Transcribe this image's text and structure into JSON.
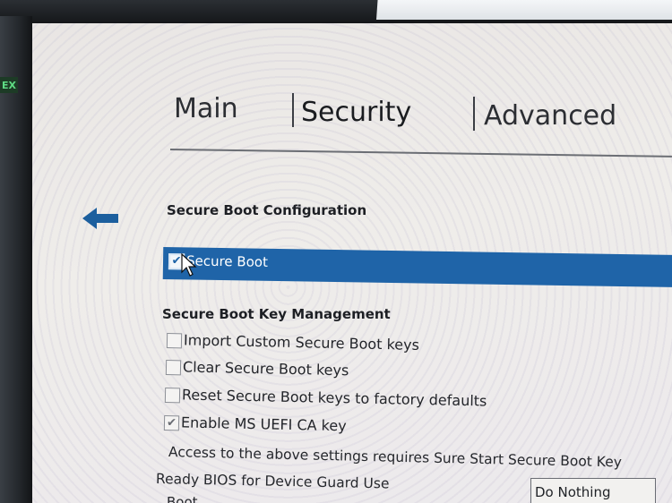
{
  "exit_sign": "EX",
  "tabs": [
    {
      "label": "Main"
    },
    {
      "label": "Security"
    },
    {
      "label": "Advanced"
    }
  ],
  "active_tab": "Security",
  "sections": {
    "secure_boot_configuration": "Secure Boot Configuration",
    "key_management": "Secure Boot Key Management"
  },
  "secure_boot": {
    "label": "Secure Boot",
    "checked": true,
    "check_glyph": "✔"
  },
  "key_options": [
    {
      "label": "Import Custom Secure Boot keys",
      "checked": false,
      "check_glyph": ""
    },
    {
      "label": "Clear Secure Boot keys",
      "checked": false,
      "check_glyph": ""
    },
    {
      "label": "Reset Secure Boot keys to factory defaults",
      "checked": false,
      "check_glyph": ""
    },
    {
      "label": "Enable MS UEFI CA key",
      "checked": true,
      "check_glyph": "✔"
    }
  ],
  "info_text": "Access to the above settings requires Sure Start Secure Boot Key",
  "device_guard": {
    "label": "Ready BIOS for Device Guard Use",
    "value": "Do Nothing"
  },
  "next_label": "Boot",
  "colors": {
    "highlight": "#1f64a8",
    "back_arrow": "#1c5f9e"
  },
  "icons": {
    "back": "back-arrow-icon",
    "pointer": "mouse-pointer-icon"
  }
}
